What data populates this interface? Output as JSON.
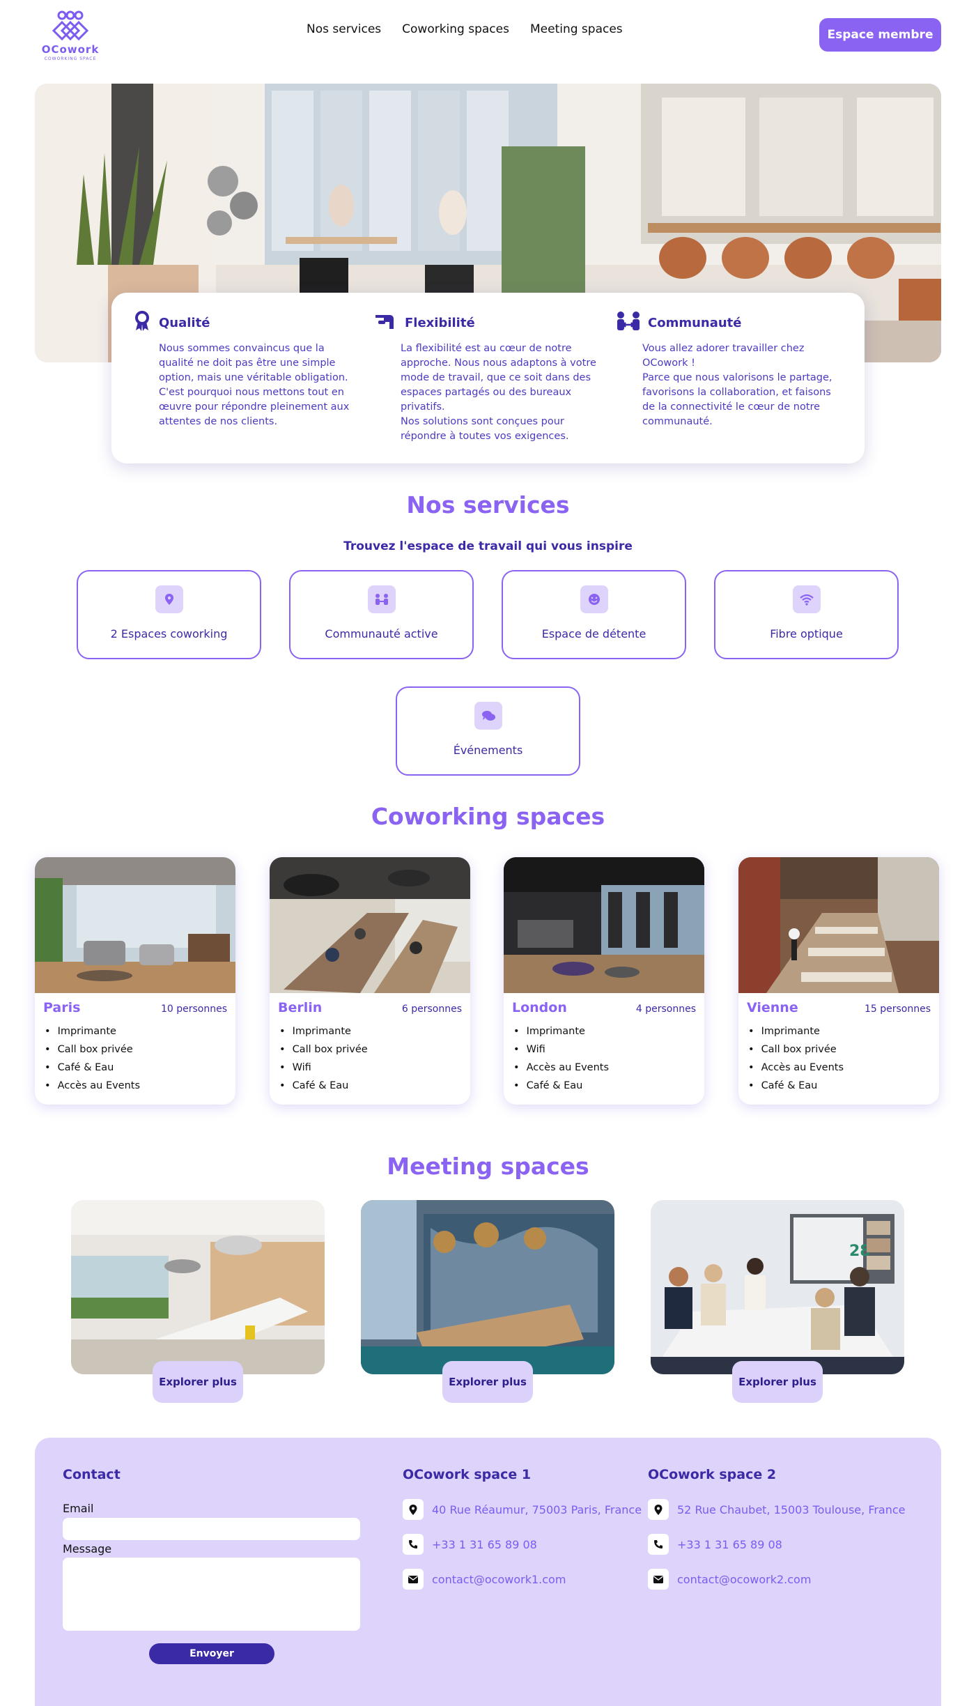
{
  "header": {
    "logo_name": "OCowork",
    "logo_sub": "COWORKING SPACE",
    "nav": [
      "Nos services",
      "Coworking spaces",
      "Meeting spaces"
    ],
    "member_button": "Espace membre"
  },
  "hero": {
    "features": [
      {
        "icon": "award-ribbon-icon",
        "title": "Qualité",
        "text": "Nous sommes convaincus que la qualité ne doit pas être une simple option, mais une véritable obligation.\nC'est pourquoi nous mettons tout en œuvre pour répondre pleinement aux attentes de nos clients."
      },
      {
        "icon": "hand-icon",
        "title": "Flexibilité",
        "text": "La flexibilité est au cœur de notre approche. Nous nous adaptons à votre mode de travail, que ce soit dans des espaces partagés ou des bureaux privatifs.\nNos solutions sont conçues pour répondre à toutes vos exigences."
      },
      {
        "icon": "people-arrows-icon",
        "title": "Communauté",
        "text": "Vous allez adorer travailler chez OCowork !\nParce que nous valorisons le partage, favorisons la collaboration, et faisons de la connectivité le cœur de notre communauté."
      }
    ]
  },
  "services": {
    "title": "Nos services",
    "subtitle": "Trouvez l'espace de travail qui vous inspire",
    "items": [
      {
        "icon": "location-pin-icon",
        "label": "2 Espaces coworking"
      },
      {
        "icon": "people-icon",
        "label": "Communauté active"
      },
      {
        "icon": "smile-icon",
        "label": "Espace de détente"
      },
      {
        "icon": "wifi-icon",
        "label": "Fibre optique"
      },
      {
        "icon": "chat-bubbles-icon",
        "label": "Événements"
      }
    ]
  },
  "coworking": {
    "title": "Coworking spaces",
    "cards": [
      {
        "city": "Paris",
        "capacity": "10 personnes",
        "features": [
          "Imprimante",
          "Call box privée",
          "Café & Eau",
          "Accès au Events"
        ]
      },
      {
        "city": "Berlin",
        "capacity": "6 personnes",
        "features": [
          "Imprimante",
          "Call box privée",
          "Wifi",
          "Café & Eau"
        ]
      },
      {
        "city": "London",
        "capacity": "4 personnes",
        "features": [
          "Imprimante",
          "Wifi",
          "Accès au Events",
          "Café & Eau"
        ]
      },
      {
        "city": "Vienne",
        "capacity": "15 personnes",
        "features": [
          "Imprimante",
          "Call box privée",
          "Accès au Events",
          "Café & Eau"
        ]
      }
    ]
  },
  "meeting": {
    "title": "Meeting spaces",
    "button_label": "Explorer plus",
    "screen_number": "28"
  },
  "footer": {
    "contact_title": "Contact",
    "email_label": "Email",
    "message_label": "Message",
    "send_label": "Envoyer",
    "space1": {
      "title": "OCowork space 1",
      "address": "40 Rue Réaumur, 75003 Paris, France",
      "phone": "+33 1 31 65 89 08",
      "email": "contact@ocowork1.com"
    },
    "space2": {
      "title": "OCowork space 2",
      "address": "52 Rue Chaubet, 15003 Toulouse, France",
      "phone": "+33 1 31 65 89 08",
      "email": "contact@ocowork2.com"
    }
  },
  "colors": {
    "accent": "#8b63f2",
    "dark": "#3b2aa6",
    "light": "#ddd3fb"
  }
}
